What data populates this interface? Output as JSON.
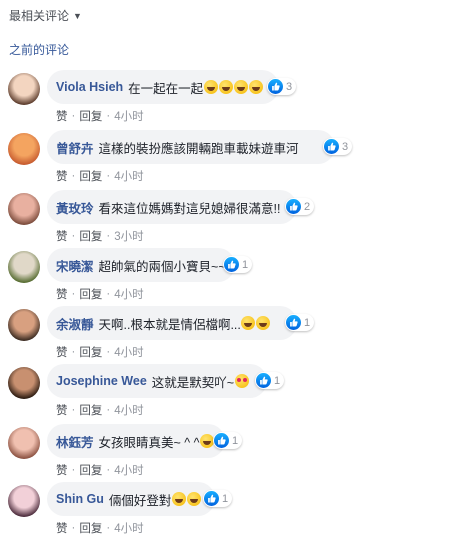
{
  "sort": {
    "label": "最相关评论"
  },
  "previous_link": "之前的评论",
  "actions": {
    "like": "赞",
    "reply": "回复",
    "sep": "·"
  },
  "colors": {
    "name": "#385898",
    "bubble": "#f2f3f5",
    "like_blue": "#1877f2"
  },
  "comments": [
    {
      "name": "Viola Hsieh",
      "text": "在一起在一起",
      "emoji": [
        "laugh",
        "laugh",
        "laugh",
        "laugh"
      ],
      "likes": "3",
      "time": "4小时"
    },
    {
      "name": "曾舒卉",
      "text": "這樣的裝扮應該開輛跑車載妹遊車河",
      "emoji": [],
      "likes": "3",
      "time": "4小时"
    },
    {
      "name": "黃玫玲",
      "text": "看來這位媽媽對這兒媳婦很滿意!!",
      "emoji": [],
      "likes": "2",
      "time": "3小时"
    },
    {
      "name": "宋曉潔",
      "text": "超帥氣的兩個小寶貝~~",
      "emoji": [],
      "likes": "1",
      "time": "4小时"
    },
    {
      "name": "余淑靜",
      "text": "天啊..根本就是情侶檔啊...",
      "emoji": [
        "laugh",
        "laugh"
      ],
      "likes": "1",
      "time": "4小时"
    },
    {
      "name": "Josephine Wee",
      "text": "这就是默契吖~",
      "emoji": [
        "heart"
      ],
      "likes": "1",
      "time": "4小时"
    },
    {
      "name": "林鈺芳",
      "text": "女孩眼睛真美~ ^ ^",
      "emoji": [
        "laugh"
      ],
      "likes": "1",
      "time": "4小时"
    },
    {
      "name": "Shin Gu",
      "text": "倆個好登對",
      "emoji": [
        "laugh",
        "laugh"
      ],
      "likes": "1",
      "time": "4小时"
    }
  ]
}
